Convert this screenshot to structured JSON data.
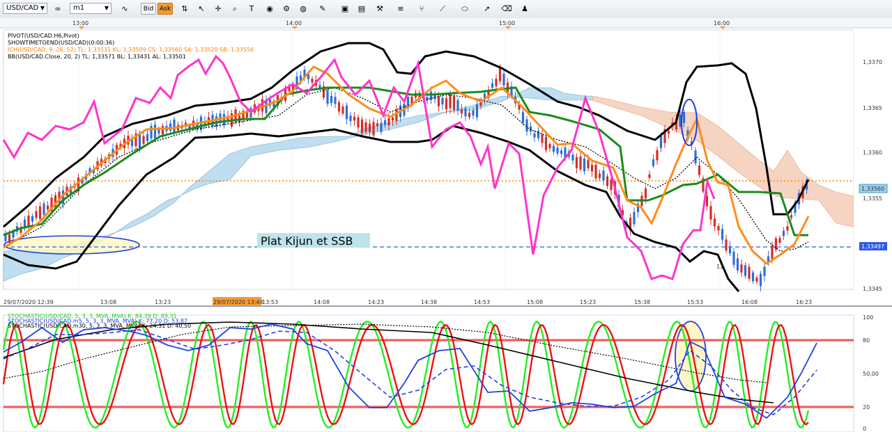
{
  "toolbar": {
    "symbol": "USD/CAD",
    "timeframe": "m1",
    "bid_label": "Bid",
    "ask_label": "Ask",
    "icons": [
      "link-icon",
      "line-chart-icon",
      "price-line-icon",
      "cursor-icon",
      "crosshair-icon",
      "zoom-icon",
      "text-icon",
      "eye-icon",
      "settings-icon",
      "globe-icon",
      "pencil-icon",
      "picture-icon",
      "window-icon",
      "tools-icon",
      "bars-icon",
      "fork-icon",
      "trendline-icon",
      "ellipse-icon",
      "arrow-icon",
      "eraser-icon",
      "people-icon"
    ]
  },
  "colors": {
    "accent": "#f39a32",
    "kijun": "#1a8a1a",
    "tenkan": "#ff8c1a",
    "chikou": "#ff33cc",
    "bollinger": "#000000",
    "cloud_bull": "#a9d3ea",
    "cloud_bear": "#f3c5ae",
    "stoch_k": "#22ee22",
    "stoch_d": "#ee1111",
    "stoch_m5": "#1f3fe0",
    "level_line": "#f06060"
  },
  "chart_data": [
    {
      "type": "candlestick",
      "title": "USD/CAD",
      "legend": [
        {
          "text": "PIVOT(USD/CAD.H6,Pivot)",
          "color": "#000000"
        },
        {
          "text": "SHOWTIMETOEND(USD/CAD)(0:00:36)",
          "color": "#000000"
        },
        {
          "text": "ICH(USD/CAD, 9, 26, 52)  TL: 1,33531  KL: 1,33509  CS: 1,33560  SA: 1,33520  SB: 1,33556",
          "color": "#ff7f00"
        },
        {
          "text": "BB(USD/CAD.Close, 20, 2)  TL: 1,33571  BL: 1,33431  AL: 1,33501",
          "color": "#000000"
        }
      ],
      "top_time_labels": [
        "13:00",
        "14:00",
        "15:00",
        "16:00"
      ],
      "x_tick_labels": [
        "29/07/2020 12:39",
        "13:08",
        "13:23",
        "29/07/2020 13:44",
        "13:53",
        "14:08",
        "14:23",
        "14:38",
        "14:53",
        "15:08",
        "15:23",
        "15:38",
        "15:53",
        "16:08",
        "16:23"
      ],
      "y_tick_labels": [
        "1,3370",
        "1,3365",
        "1,3360",
        "1,3355",
        "1,3345"
      ],
      "ylim": [
        1.3344,
        1.3372
      ],
      "current_price_label": "1,33560",
      "blue_line_label": "1,33497",
      "orange_level": 1.3357,
      "blue_level": 1.33497,
      "annotation": "Plat Kijun et SSB",
      "marker_label": "11",
      "series": [
        {
          "name": "Bollinger upper",
          "color": "#000000",
          "x": [
            0,
            6,
            12,
            18,
            24,
            30,
            36,
            42,
            48,
            54,
            60,
            66,
            72,
            78,
            84,
            90,
            96,
            102,
            108,
            114,
            120
          ],
          "y": [
            1.3351,
            1.3358,
            1.3364,
            1.3365,
            1.3365,
            1.3366,
            1.3369,
            1.3371,
            1.3371,
            1.3371,
            1.3368,
            1.3369,
            1.3369,
            1.3367,
            1.3365,
            1.3365,
            1.3365,
            1.3368,
            1.3369,
            1.3369,
            1.3362
          ]
        },
        {
          "name": "Bollinger lower",
          "color": "#000000",
          "x": [
            0,
            6,
            12,
            18,
            24,
            30,
            36,
            42,
            48,
            54,
            60,
            66,
            72,
            78,
            84,
            90,
            96,
            102,
            108,
            114,
            120
          ],
          "y": [
            1.3347,
            1.3348,
            1.3352,
            1.3356,
            1.336,
            1.3362,
            1.3362,
            1.3363,
            1.3363,
            1.3362,
            1.3362,
            1.3363,
            1.3361,
            1.3358,
            1.3354,
            1.3349,
            1.3348,
            1.3348,
            1.3344,
            1.3349,
            1.3357
          ]
        },
        {
          "name": "Kijun",
          "color": "#1a8a1a",
          "x": [
            0,
            6,
            12,
            18,
            24,
            30,
            36,
            42,
            48,
            54,
            60,
            66,
            72,
            78,
            84,
            90,
            96,
            102,
            108,
            114,
            120
          ],
          "y": [
            1.3352,
            1.3353,
            1.3356,
            1.3362,
            1.3363,
            1.3364,
            1.3364,
            1.3367,
            1.3367,
            1.3367,
            1.3367,
            1.3367,
            1.3367,
            1.3364,
            1.3364,
            1.3359,
            1.3355,
            1.3357,
            1.3357,
            1.3354,
            1.3352
          ]
        },
        {
          "name": "Tenkan",
          "color": "#ff8c1a",
          "x": [
            0,
            6,
            12,
            18,
            24,
            30,
            36,
            42,
            48,
            54,
            60,
            66,
            72,
            78,
            84,
            90,
            96,
            102,
            108,
            114,
            120
          ],
          "y": [
            1.3351,
            1.3355,
            1.336,
            1.3363,
            1.3363,
            1.3364,
            1.3366,
            1.3369,
            1.3366,
            1.3365,
            1.3367,
            1.3367,
            1.3365,
            1.3362,
            1.3361,
            1.3356,
            1.3358,
            1.3366,
            1.3355,
            1.335,
            1.3352
          ]
        },
        {
          "name": "Chikou",
          "color": "#ff33cc",
          "x": [
            0,
            6,
            12,
            18,
            24,
            30,
            36,
            42,
            48,
            54,
            60,
            66,
            72,
            78,
            84,
            90,
            96,
            102,
            108,
            114,
            120
          ],
          "y": [
            1.3361,
            1.3363,
            1.3365,
            1.3366,
            1.3366,
            1.337,
            1.3368,
            1.3369,
            1.3368,
            1.3365,
            1.3366,
            1.3368,
            1.3362,
            1.3359,
            1.3357,
            1.3363,
            1.3351,
            1.335,
            1.3355,
            1.3356,
            1.3357
          ]
        }
      ]
    },
    {
      "type": "line",
      "title": "Stochastic",
      "legend": [
        {
          "text": "STOCHASTIC(USD/CAD, 5, 3, 3, MVA, MVA)  K: 84,39  D: 89,31",
          "color": "#22cc22"
        },
        {
          "text": "STOCHASTIC(USD/CAD.m5, 5, 3, 3, MVA, MVA)  K: 77,20  D: 53,87",
          "color": "#1f3fe0"
        },
        {
          "text": "STOCHASTIC(USD/CAD.m30, 5, 3, 3, MVA, MVA)  K: 24,31  D: 40,50",
          "color": "#000000"
        }
      ],
      "y_tick_labels": [
        "100",
        "80",
        "50,00",
        "20",
        "0"
      ],
      "ylim": [
        0,
        100
      ],
      "levels": [
        80,
        20
      ],
      "series": [
        {
          "name": "m5 %K",
          "color": "#1f3fe0",
          "x": [
            0,
            6,
            12,
            18,
            24,
            30,
            36,
            42,
            48,
            54,
            60,
            66,
            72,
            78,
            84,
            90,
            96,
            102,
            108,
            114,
            120
          ],
          "y": [
            70,
            85,
            70,
            60,
            80,
            75,
            60,
            65,
            80,
            55,
            30,
            40,
            80,
            60,
            30,
            35,
            40,
            70,
            25,
            40,
            70
          ]
        },
        {
          "name": "m30 %K",
          "color": "#000000",
          "x": [
            0,
            20,
            40,
            60,
            80,
            100,
            110
          ],
          "y": [
            72,
            90,
            96,
            92,
            55,
            25,
            23
          ]
        }
      ]
    }
  ]
}
